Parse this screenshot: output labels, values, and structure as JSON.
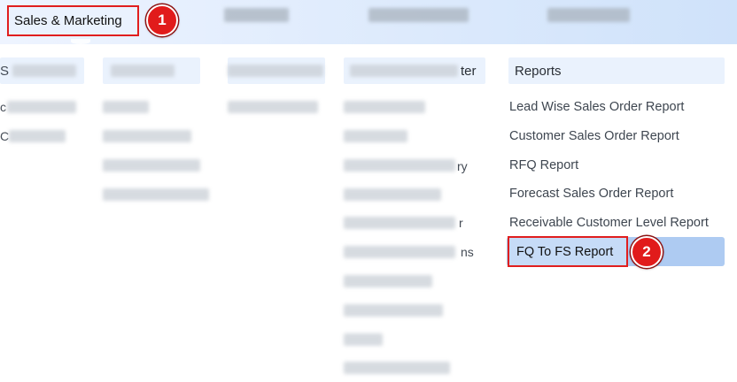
{
  "nav": {
    "active_tab": "Sales & Marketing"
  },
  "columns": {
    "col1_header_fragment": "S",
    "col1_fragment_a": "c",
    "col1_fragment_b": "C",
    "col4_header_fragment": "ter",
    "col4_fragment_a": "ry",
    "col4_fragment_b": "r",
    "col4_fragment_c": "ns"
  },
  "reports": {
    "header": "Reports",
    "items": [
      "Lead Wise Sales Order Report",
      "Customer Sales Order Report",
      "RFQ Report",
      "Forecast Sales Order Report",
      "Receivable Customer Level Report",
      "FQ To FS Report"
    ]
  },
  "steps": {
    "step1": "1",
    "step2": "2"
  },
  "colors": {
    "highlight_border": "#e01e1e",
    "badge": "#e11b1b",
    "active_item_bg": "#aecbf2",
    "header_bg": "#eaf2fd"
  }
}
